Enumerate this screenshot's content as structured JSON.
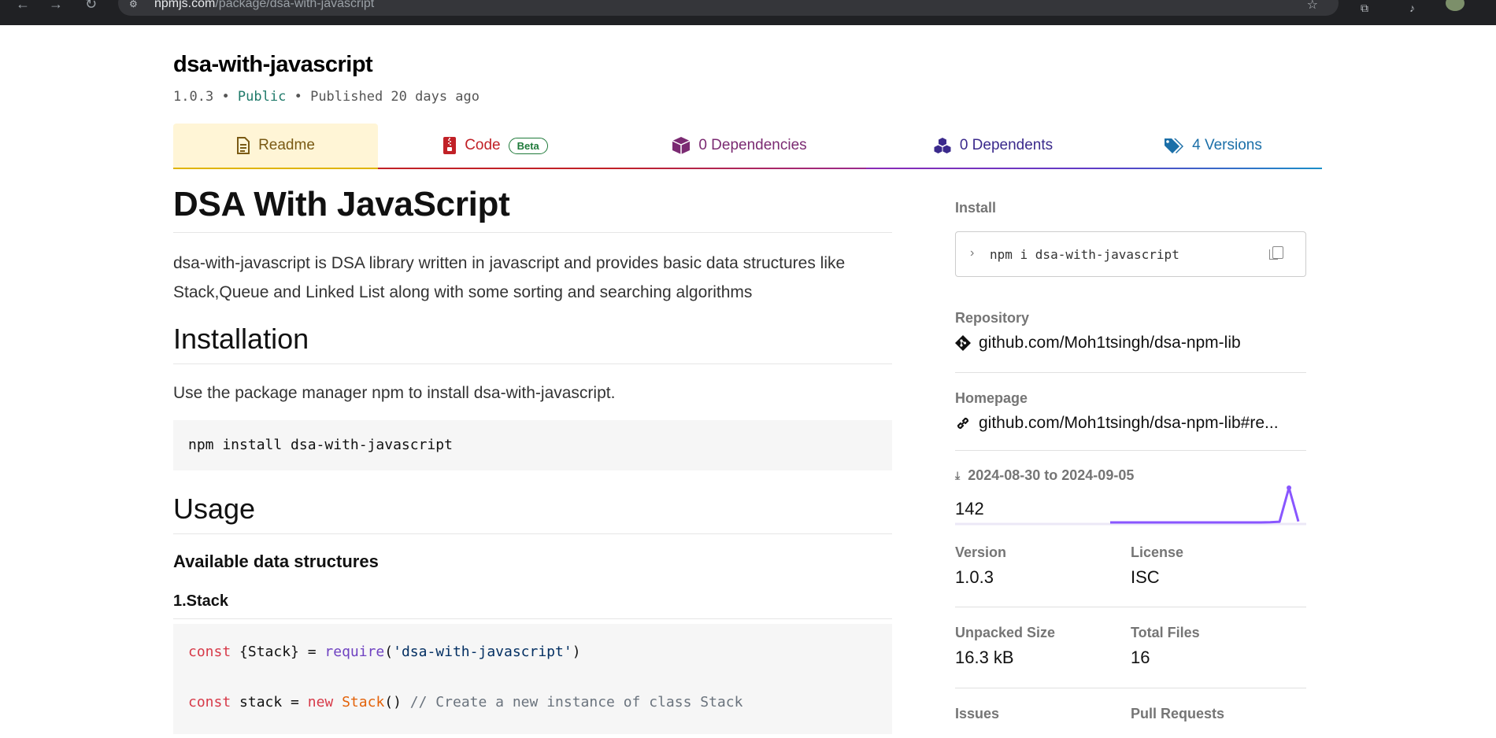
{
  "browser": {
    "url_host": "npmjs.com",
    "url_path": "/package/dsa-with-javascript"
  },
  "package": {
    "name": "dsa-with-javascript",
    "version": "1.0.3",
    "visibility": "Public",
    "published": "Published 20 days ago"
  },
  "tabs": {
    "readme": "Readme",
    "code": "Code",
    "code_badge": "Beta",
    "dependencies": "0 Dependencies",
    "dependents": "0 Dependents",
    "versions": "4 Versions"
  },
  "readme": {
    "title": "DSA With JavaScript",
    "intro": "dsa-with-javascript is DSA library written in javascript and provides basic data structures like Stack,Queue and Linked List along with some sorting and searching algorithms",
    "installation_heading": "Installation",
    "installation_text": "Use the package manager npm to install dsa-with-javascript.",
    "install_code": "npm install dsa-with-javascript",
    "usage_heading": "Usage",
    "available_heading": "Available data structures",
    "stack_heading": "1.Stack",
    "code_line1": {
      "kw": "const",
      "brace": " {Stack} = ",
      "fn": "require",
      "open": "(",
      "str": "'dsa-with-javascript'",
      "close": ")"
    },
    "code_line2": {
      "kw": "const",
      "mid": " stack = ",
      "kw2": "new",
      "sp": " ",
      "cls": "Stack",
      "paren": "() ",
      "comment": "// Create a new instance of class Stack"
    }
  },
  "sidebar": {
    "install_label": "Install",
    "install_cmd": "npm i dsa-with-javascript",
    "repository_label": "Repository",
    "repository_link": "github.com/Moh1tsingh/dsa-npm-lib",
    "homepage_label": "Homepage",
    "homepage_link": "github.com/Moh1tsingh/dsa-npm-lib#re...",
    "downloads_range": "2024-08-30 to 2024-09-05",
    "downloads_count": "142",
    "version_label": "Version",
    "version_value": "1.0.3",
    "license_label": "License",
    "license_value": "ISC",
    "unpacked_label": "Unpacked Size",
    "unpacked_value": "16.3 kB",
    "files_label": "Total Files",
    "files_value": "16",
    "issues_label": "Issues",
    "pulls_label": "Pull Requests"
  },
  "colors": {
    "readme_tab": "#fff5d6",
    "code_tab": "#c12127",
    "dependencies_tab": "#7b2a72",
    "dependents_tab": "#3b2a8c",
    "versions_tab": "#1b6fa8",
    "sparkline": "#8956ff"
  },
  "icons": {
    "readme": "document-icon",
    "code": "zip-file-icon",
    "dependencies": "box-icon",
    "dependents": "boxes-icon",
    "versions": "tags-icon",
    "repository": "git-icon",
    "homepage": "link-icon",
    "downloads": "download-icon"
  },
  "downloads_sparkline": {
    "values": [
      0,
      0,
      0,
      0,
      0,
      0,
      0,
      0,
      0,
      0,
      0,
      0,
      0,
      0,
      0,
      0,
      0,
      1,
      3,
      142,
      4
    ]
  }
}
